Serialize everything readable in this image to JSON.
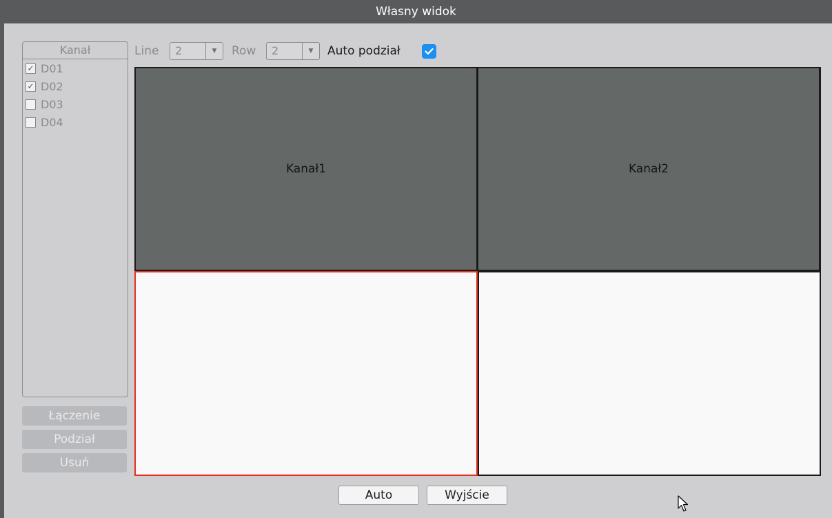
{
  "window": {
    "title": "Własny widok"
  },
  "channel_panel": {
    "header": "Kanał",
    "items": [
      {
        "label": "D01",
        "checked": true
      },
      {
        "label": "D02",
        "checked": true
      },
      {
        "label": "D03",
        "checked": false
      },
      {
        "label": "D04",
        "checked": false
      }
    ]
  },
  "side_buttons": {
    "merge": "Łączenie",
    "split": "Podział",
    "delete": "Usuń"
  },
  "controls": {
    "line_label": "Line",
    "line_value": "2",
    "row_label": "Row",
    "row_value": "2",
    "auto_split_label": "Auto podział",
    "auto_split_checked": true
  },
  "grid": {
    "cells": [
      {
        "label": "Kanał1",
        "state": "assigned"
      },
      {
        "label": "Kanał2",
        "state": "assigned"
      },
      {
        "label": "",
        "state": "selected"
      },
      {
        "label": "",
        "state": "empty"
      }
    ]
  },
  "footer": {
    "auto_label": "Auto",
    "exit_label": "Wyjście"
  },
  "colors": {
    "accent": "#1e8ef0",
    "selection": "#e2301e",
    "titlebar": "#595a5c",
    "tile": "#646968"
  }
}
